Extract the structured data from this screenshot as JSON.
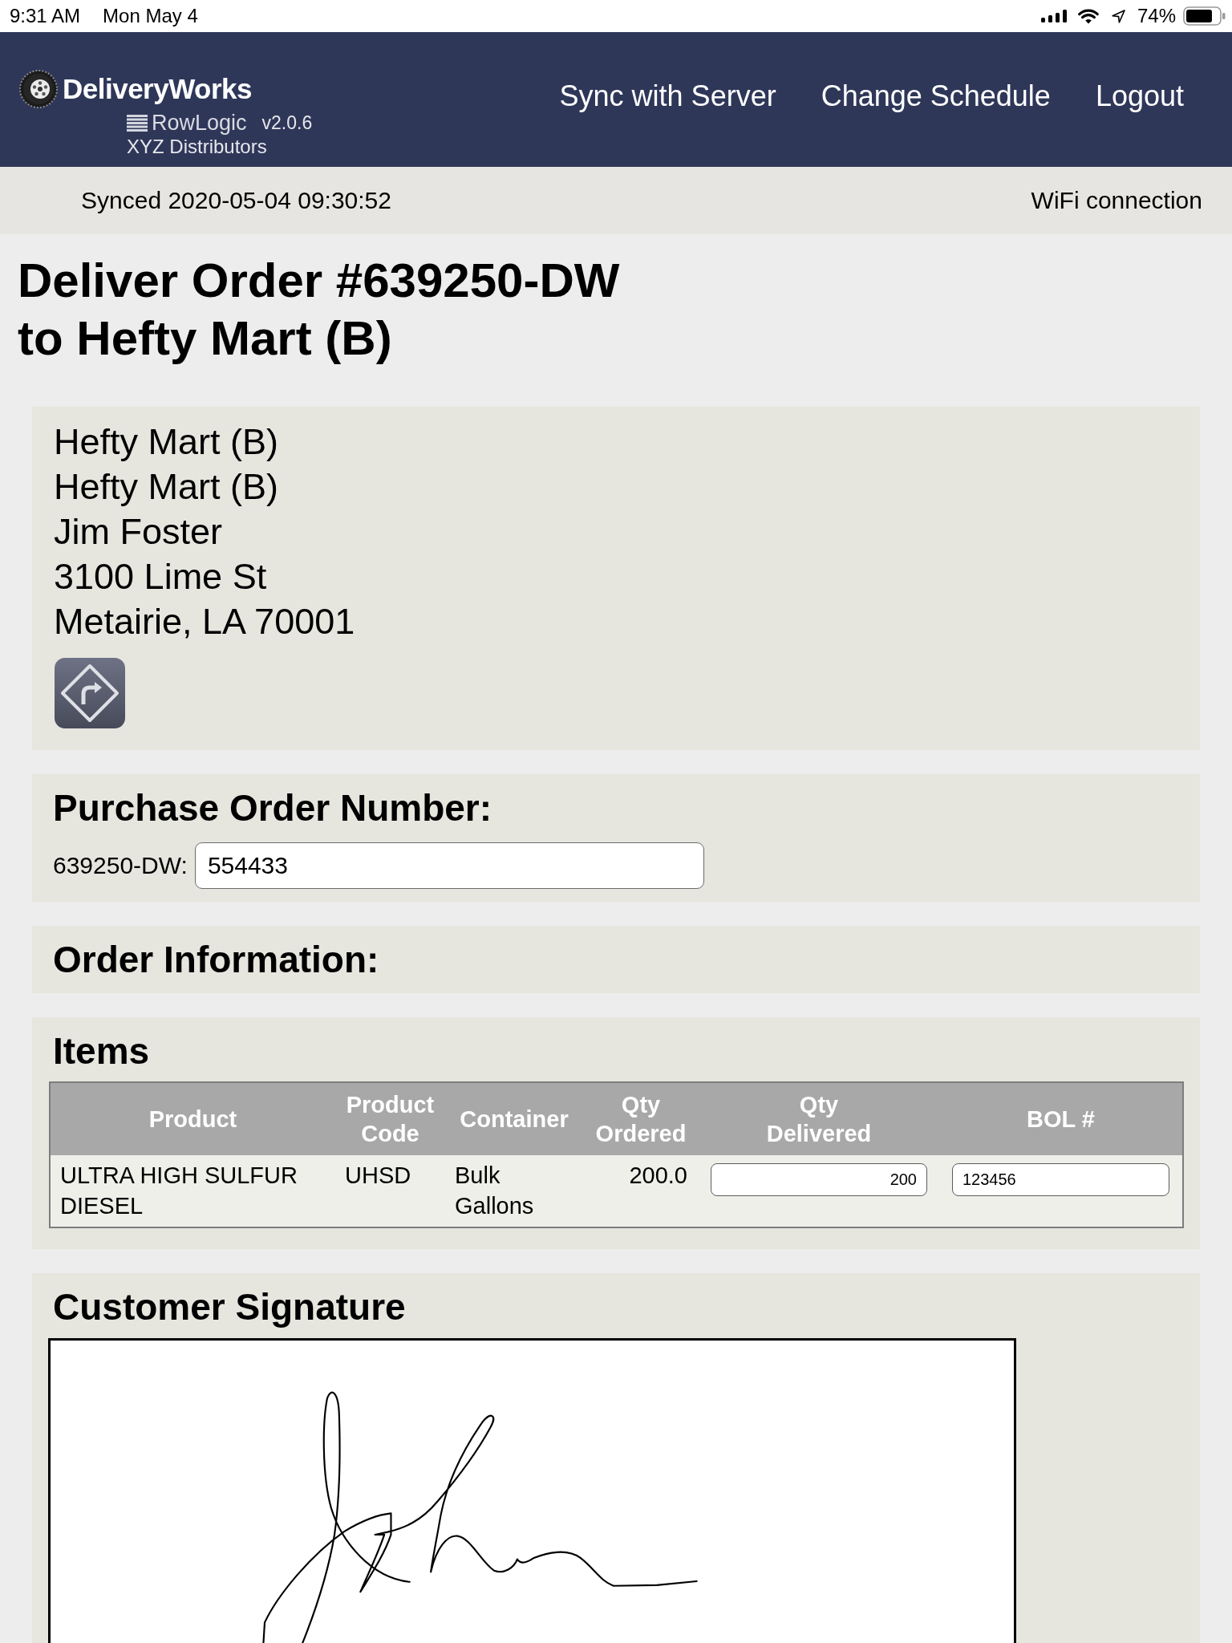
{
  "status_bar": {
    "time": "9:31 AM",
    "date": "Mon May 4",
    "battery": "74%"
  },
  "header": {
    "logo": "DeliveryWorks",
    "brand": "RowLogic",
    "version": "v2.0.6",
    "company": "XYZ Distributors",
    "nav": [
      "Sync with Server",
      "Change Schedule",
      "Logout"
    ]
  },
  "sync_bar": {
    "synced": "Synced 2020-05-04 09:30:52",
    "connection": "WiFi connection"
  },
  "title": [
    "Deliver Order #639250-DW",
    "to Hefty Mart (B)"
  ],
  "address": {
    "lines": [
      "Hefty Mart (B)",
      "Hefty Mart (B)",
      "Jim Foster",
      "3100 Lime St",
      "Metairie, LA 70001"
    ]
  },
  "purchase_order": {
    "heading": "Purchase Order Number:",
    "label": "639250-DW:",
    "value": "554433"
  },
  "order_information": {
    "heading": "Order Information:"
  },
  "items": {
    "heading": "Items",
    "columns": [
      "Product",
      "Product Code",
      "Container",
      "Qty Ordered",
      "Qty Delivered",
      "BOL #"
    ],
    "rows": [
      {
        "product": "ULTRA HIGH SULFUR DIESEL",
        "product_code": "UHSD",
        "container": "Bulk Gallons",
        "qty_ordered": "200.0",
        "qty_delivered": "200",
        "bol": "123456"
      }
    ]
  },
  "signature": {
    "heading": "Customer Signature"
  }
}
